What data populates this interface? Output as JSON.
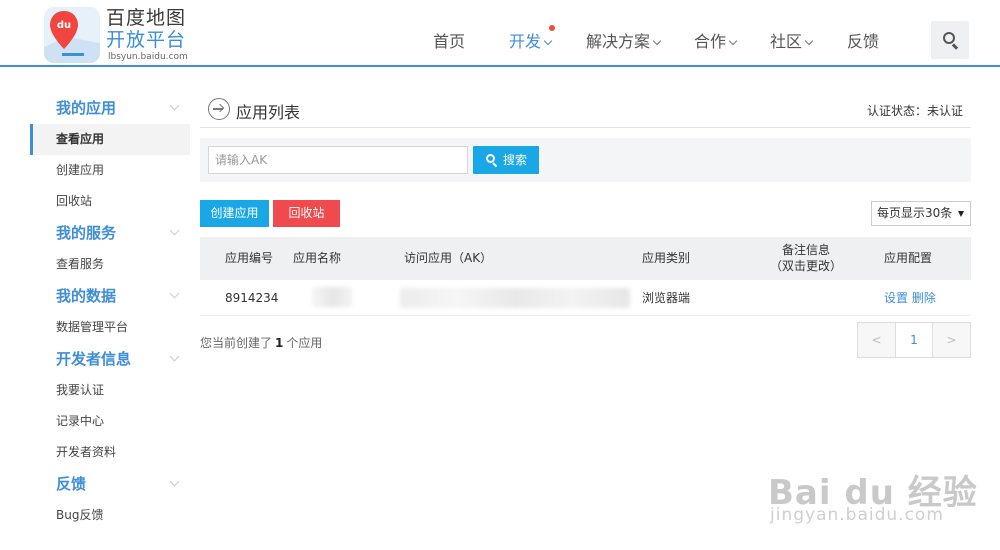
{
  "brand": {
    "line1": "百度地图",
    "line2": "开放平台",
    "url": "lbsyun.baidu.com",
    "logo_letters": "du"
  },
  "nav": {
    "items": [
      {
        "label": "首页"
      },
      {
        "label": "开发"
      },
      {
        "label": "解决方案"
      },
      {
        "label": "合作"
      },
      {
        "label": "社区"
      },
      {
        "label": "反馈"
      }
    ]
  },
  "sidebar": {
    "groups": [
      {
        "title": "我的应用",
        "items": [
          "查看应用",
          "创建应用",
          "回收站"
        ]
      },
      {
        "title": "我的服务",
        "items": [
          "查看服务"
        ]
      },
      {
        "title": "我的数据",
        "items": [
          "数据管理平台"
        ]
      },
      {
        "title": "开发者信息",
        "items": [
          "我要认证",
          "记录中心",
          "开发者资料"
        ]
      },
      {
        "title": "反馈",
        "items": [
          "Bug反馈"
        ]
      }
    ]
  },
  "main": {
    "title": "应用列表",
    "auth_status": "认证状态：未认证",
    "search": {
      "placeholder": "请输入AK",
      "button_label": "搜索"
    },
    "actions": {
      "create_label": "创建应用",
      "recycle_label": "回收站",
      "perpage_label": "每页显示30条"
    },
    "table": {
      "headers": {
        "id": "应用编号",
        "name": "应用名称",
        "ak": "访问应用（AK）",
        "type": "应用类别",
        "note_line1": "备注信息",
        "note_line2": "（双击更改）",
        "config": "应用配置"
      },
      "rows": [
        {
          "id": "8914234",
          "type": "浏览器端",
          "setting": "设置",
          "delete": "删除"
        }
      ]
    },
    "count_prefix": "您当前创建了",
    "count_value": "1",
    "count_suffix": "个应用",
    "pager": {
      "prev": "<",
      "current": "1",
      "next": ">"
    }
  },
  "watermark": {
    "text": "Bai du 经验",
    "url": "jingyan.baidu.com"
  },
  "colors": {
    "accent": "#3f8ed8",
    "primary_button": "#1aa7e6",
    "danger_button": "#f04a4f",
    "notify_dot": "#f04a3e"
  }
}
